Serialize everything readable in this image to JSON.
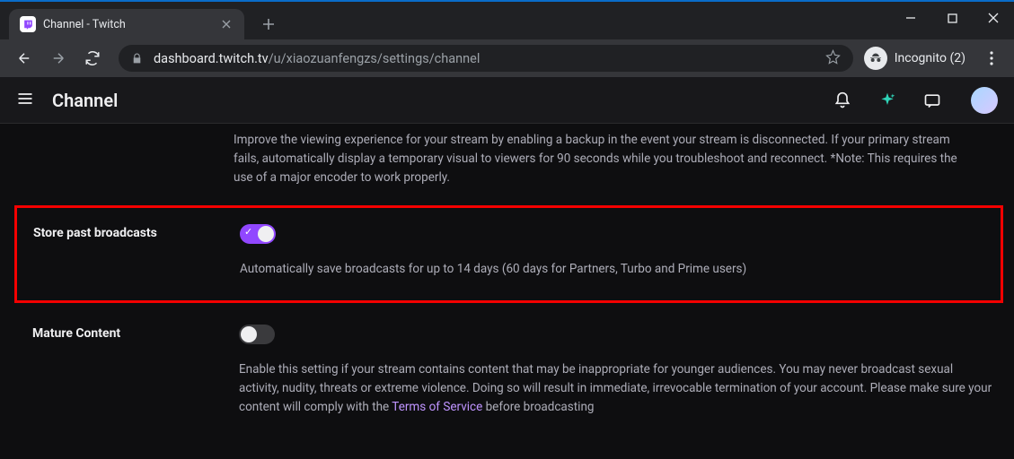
{
  "browser": {
    "tab_title": "Channel - Twitch",
    "url_host": "dashboard.twitch.tv",
    "url_path": "/u/xiaozuanfengzs/settings/channel",
    "incognito_label": "Incognito (2)"
  },
  "header": {
    "page_title": "Channel"
  },
  "settings_top_desc": "Improve the viewing experience for your stream by enabling a backup in the event your stream is disconnected. If your primary stream fails, automatically display a temporary visual to viewers for 90 seconds while you troubleshoot and reconnect. *Note: This requires the use of a major encoder to work properly.",
  "store_past": {
    "label": "Store past broadcasts",
    "desc": "Automatically save broadcasts for up to 14 days (60 days for Partners, Turbo and Prime users)"
  },
  "mature": {
    "label": "Mature Content",
    "desc_pre": "Enable this setting if your stream contains content that may be inappropriate for younger audiences. You may never broadcast sexual activity, nudity, threats or extreme violence. Doing so will result in immediate, irrevocable termination of your account. Please make sure your content will comply with the ",
    "tos_link": "Terms of Service",
    "desc_post": " before broadcasting"
  }
}
